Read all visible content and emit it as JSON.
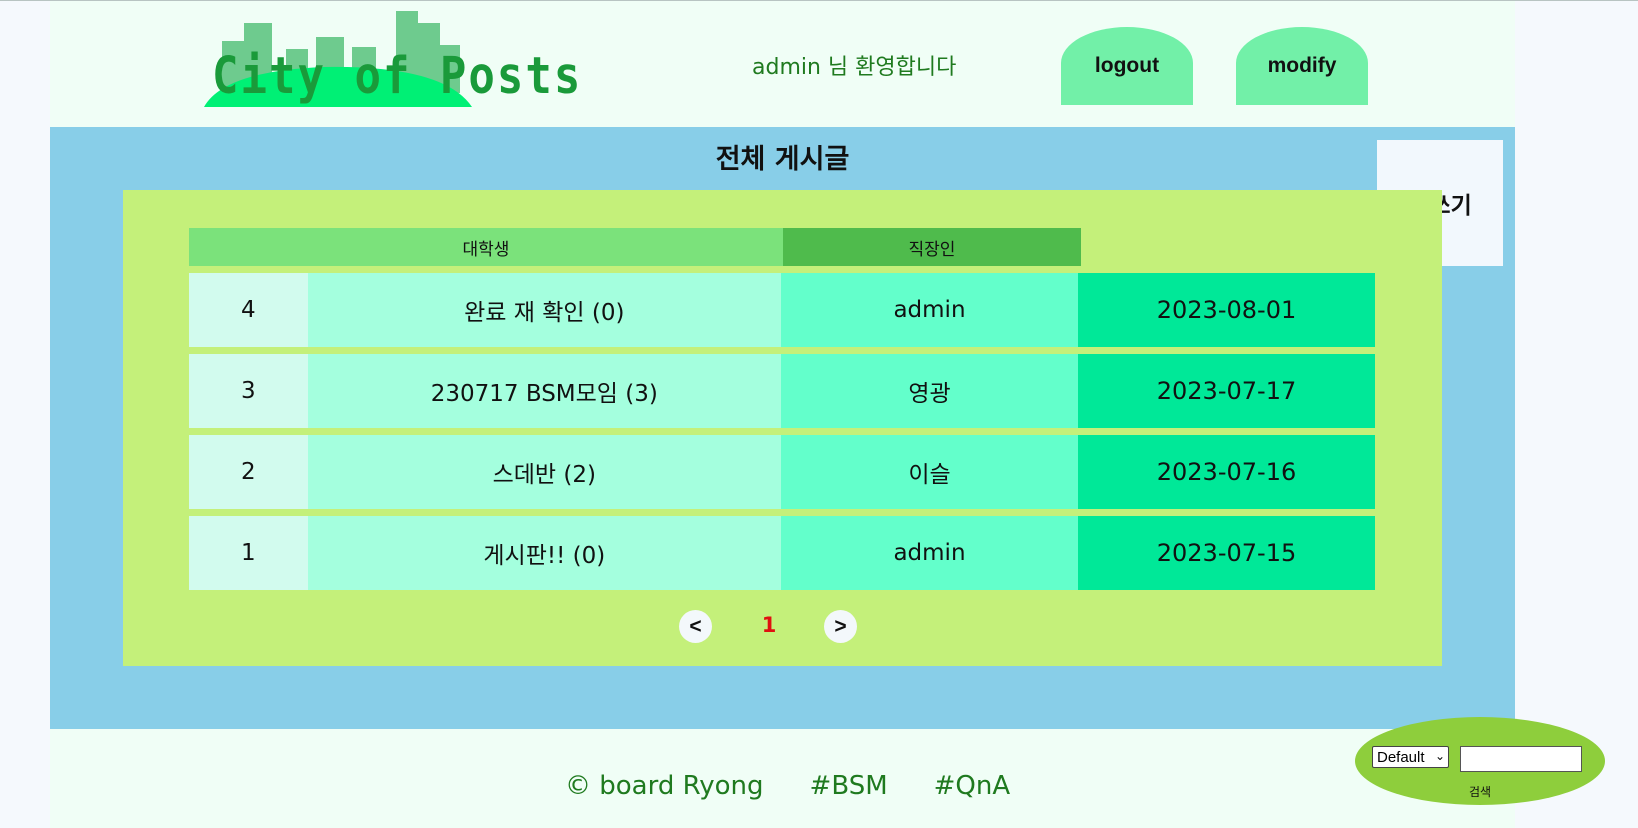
{
  "header": {
    "logo_text": "City of Posts",
    "welcome": "admin 님 환영합니다",
    "logout_label": "logout",
    "modify_label": "modify"
  },
  "board": {
    "title": "전체 게시글",
    "write_label": "글쓰기",
    "column_heads": [
      "대학생",
      "직장인"
    ],
    "posts": [
      {
        "num": "4",
        "title": "완료 재 확인 (0)",
        "author": "admin",
        "date": "2023-08-01"
      },
      {
        "num": "3",
        "title": "230717 BSM모임 (3)",
        "author": "영광",
        "date": "2023-07-17"
      },
      {
        "num": "2",
        "title": "스데반 (2)",
        "author": "이슬",
        "date": "2023-07-16"
      },
      {
        "num": "1",
        "title": "게시판!! (0)",
        "author": "admin",
        "date": "2023-07-15"
      }
    ]
  },
  "pagination": {
    "prev_label": "<",
    "current_page": "1",
    "next_label": ">"
  },
  "footer": {
    "copyright": "© board Ryong",
    "tag_bsm": "#BSM",
    "tag_qna": "#QnA"
  },
  "search": {
    "select_value": "Default",
    "input_value": "",
    "button_label": "검색"
  },
  "colors": {
    "page_bg": "#f0fef6",
    "main_bg": "#88cee8",
    "board_bg": "#c4f07a",
    "header_button": "#72f0a8",
    "accent_green_text": "#1f7a1f",
    "current_page": "#e01010",
    "search_oval": "#8ece3c"
  }
}
